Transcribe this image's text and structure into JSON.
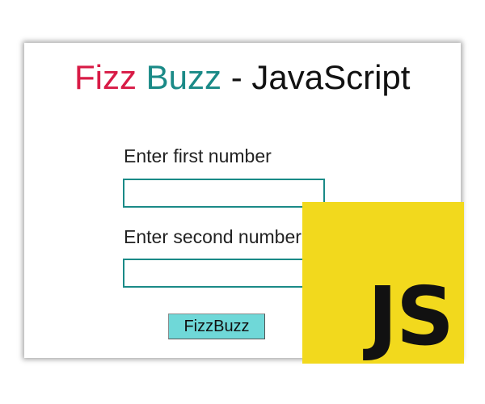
{
  "title": {
    "fizz": "Fizz",
    "buzz": "Buzz",
    "rest": " - JavaScript"
  },
  "form": {
    "first_label": "Enter first number",
    "first_value": "",
    "second_label": "Enter second number",
    "second_value": "",
    "button_label": "FizzBuzz"
  },
  "logo": {
    "text": "JS"
  },
  "colors": {
    "fizz": "#d81b46",
    "buzz": "#1a8a87",
    "input_border": "#1a8a87",
    "button_bg": "#6fd8d8",
    "logo_bg": "#f2d91d"
  }
}
